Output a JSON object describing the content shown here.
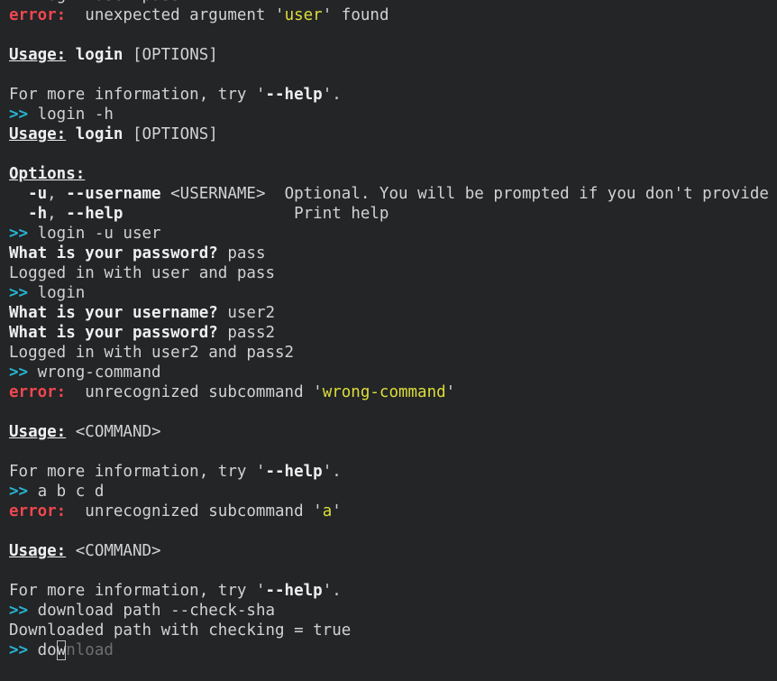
{
  "terminal": {
    "name": "cli-repl-terminal",
    "background_color": "#232527",
    "foreground_color": "#d2d2d2",
    "prompt_symbol": ">>",
    "colors": {
      "prompt": "#27b6d4",
      "error": "#f0474f",
      "literal": "#dddd3b",
      "strong": "#efefef",
      "ghost": "#6d6f71",
      "default": "#d2d2d2"
    },
    "clipped_top_line": true,
    "lines": [
      {
        "id": "l0",
        "segments": [
          {
            "text": ">>",
            "style": "prompt"
          },
          {
            "text": " login user pass",
            "style": "default"
          }
        ]
      },
      {
        "id": "l1",
        "segments": [
          {
            "text": "error:",
            "style": "error"
          },
          {
            "text": "  unexpected argument ",
            "style": "default"
          },
          {
            "text": "'",
            "style": "default"
          },
          {
            "text": "user",
            "style": "literal"
          },
          {
            "text": "'",
            "style": "default"
          },
          {
            "text": " found",
            "style": "default"
          }
        ]
      },
      {
        "id": "l2",
        "segments": [
          {
            "text": "",
            "style": "default"
          }
        ]
      },
      {
        "id": "l3",
        "segments": [
          {
            "text": "Usage:",
            "style": "heading"
          },
          {
            "text": " ",
            "style": "default"
          },
          {
            "text": "login",
            "style": "strong"
          },
          {
            "text": " [OPTIONS]",
            "style": "default"
          }
        ]
      },
      {
        "id": "l4",
        "segments": [
          {
            "text": "",
            "style": "default"
          }
        ]
      },
      {
        "id": "l5",
        "segments": [
          {
            "text": "For more information, try ",
            "style": "default"
          },
          {
            "text": "'",
            "style": "default"
          },
          {
            "text": "--help",
            "style": "strong"
          },
          {
            "text": "'.",
            "style": "default"
          }
        ]
      },
      {
        "id": "l6",
        "segments": [
          {
            "text": ">>",
            "style": "prompt"
          },
          {
            "text": " login -h",
            "style": "default"
          }
        ]
      },
      {
        "id": "l7",
        "segments": [
          {
            "text": "Usage:",
            "style": "heading"
          },
          {
            "text": " ",
            "style": "default"
          },
          {
            "text": "login",
            "style": "strong"
          },
          {
            "text": " [OPTIONS]",
            "style": "default"
          }
        ]
      },
      {
        "id": "l8",
        "segments": [
          {
            "text": "",
            "style": "default"
          }
        ]
      },
      {
        "id": "l9",
        "segments": [
          {
            "text": "Options:",
            "style": "heading"
          }
        ]
      },
      {
        "id": "l10",
        "segments": [
          {
            "text": "  ",
            "style": "default"
          },
          {
            "text": "-u",
            "style": "strong"
          },
          {
            "text": ", ",
            "style": "default"
          },
          {
            "text": "--username",
            "style": "strong"
          },
          {
            "text": " <USERNAME>",
            "style": "default"
          },
          {
            "text": "  Optional. You will be prompted if you don't provide it",
            "style": "default"
          }
        ]
      },
      {
        "id": "l11",
        "segments": [
          {
            "text": "  ",
            "style": "default"
          },
          {
            "text": "-h",
            "style": "strong"
          },
          {
            "text": ", ",
            "style": "default"
          },
          {
            "text": "--help",
            "style": "strong"
          },
          {
            "text": "                  Print help",
            "style": "default"
          }
        ]
      },
      {
        "id": "l12",
        "segments": [
          {
            "text": ">>",
            "style": "prompt"
          },
          {
            "text": " login -u user",
            "style": "default"
          }
        ]
      },
      {
        "id": "l13",
        "segments": [
          {
            "text": "What is your password?",
            "style": "strong"
          },
          {
            "text": " pass",
            "style": "default"
          }
        ]
      },
      {
        "id": "l14",
        "segments": [
          {
            "text": "Logged in with user and pass",
            "style": "default"
          }
        ]
      },
      {
        "id": "l15",
        "segments": [
          {
            "text": ">>",
            "style": "prompt"
          },
          {
            "text": " login",
            "style": "default"
          }
        ]
      },
      {
        "id": "l16",
        "segments": [
          {
            "text": "What is your username?",
            "style": "strong"
          },
          {
            "text": " user2",
            "style": "default"
          }
        ]
      },
      {
        "id": "l17",
        "segments": [
          {
            "text": "What is your password?",
            "style": "strong"
          },
          {
            "text": " pass2",
            "style": "default"
          }
        ]
      },
      {
        "id": "l18",
        "segments": [
          {
            "text": "Logged in with user2 and pass2",
            "style": "default"
          }
        ]
      },
      {
        "id": "l19",
        "segments": [
          {
            "text": ">>",
            "style": "prompt"
          },
          {
            "text": " wrong-command",
            "style": "default"
          }
        ]
      },
      {
        "id": "l20",
        "segments": [
          {
            "text": "error:",
            "style": "error"
          },
          {
            "text": "  unrecognized subcommand ",
            "style": "default"
          },
          {
            "text": "'",
            "style": "default"
          },
          {
            "text": "wrong-command",
            "style": "literal"
          },
          {
            "text": "'",
            "style": "default"
          }
        ]
      },
      {
        "id": "l21",
        "segments": [
          {
            "text": "",
            "style": "default"
          }
        ]
      },
      {
        "id": "l22",
        "segments": [
          {
            "text": "Usage:",
            "style": "heading"
          },
          {
            "text": " <COMMAND>",
            "style": "default"
          }
        ]
      },
      {
        "id": "l23",
        "segments": [
          {
            "text": "",
            "style": "default"
          }
        ]
      },
      {
        "id": "l24",
        "segments": [
          {
            "text": "For more information, try ",
            "style": "default"
          },
          {
            "text": "'",
            "style": "default"
          },
          {
            "text": "--help",
            "style": "strong"
          },
          {
            "text": "'.",
            "style": "default"
          }
        ]
      },
      {
        "id": "l25",
        "segments": [
          {
            "text": ">>",
            "style": "prompt"
          },
          {
            "text": " a b c d",
            "style": "default"
          }
        ]
      },
      {
        "id": "l26",
        "segments": [
          {
            "text": "error:",
            "style": "error"
          },
          {
            "text": "  unrecognized subcommand ",
            "style": "default"
          },
          {
            "text": "'",
            "style": "default"
          },
          {
            "text": "a",
            "style": "literal"
          },
          {
            "text": "'",
            "style": "default"
          }
        ]
      },
      {
        "id": "l27",
        "segments": [
          {
            "text": "",
            "style": "default"
          }
        ]
      },
      {
        "id": "l28",
        "segments": [
          {
            "text": "Usage:",
            "style": "heading"
          },
          {
            "text": " <COMMAND>",
            "style": "default"
          }
        ]
      },
      {
        "id": "l29",
        "segments": [
          {
            "text": "",
            "style": "default"
          }
        ]
      },
      {
        "id": "l30",
        "segments": [
          {
            "text": "For more information, try ",
            "style": "default"
          },
          {
            "text": "'",
            "style": "default"
          },
          {
            "text": "--help",
            "style": "strong"
          },
          {
            "text": "'.",
            "style": "default"
          }
        ]
      },
      {
        "id": "l31",
        "segments": [
          {
            "text": ">>",
            "style": "prompt"
          },
          {
            "text": " download path --check-sha",
            "style": "default"
          }
        ]
      },
      {
        "id": "l32",
        "segments": [
          {
            "text": "Downloaded path with checking = true",
            "style": "default"
          }
        ]
      },
      {
        "id": "l33",
        "is_input": true,
        "segments": [
          {
            "text": ">>",
            "style": "prompt"
          },
          {
            "text": " do",
            "style": "default"
          },
          {
            "text": "w",
            "style": "cursor"
          },
          {
            "text": "nload",
            "style": "ghost"
          }
        ]
      }
    ],
    "current_input": {
      "typed": "do",
      "cursor_char": "w",
      "suggestion_remainder": "nload",
      "full_suggestion": "download"
    }
  }
}
